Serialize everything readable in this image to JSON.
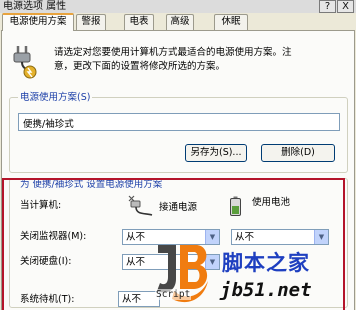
{
  "window": {
    "title": "电源选项 属性",
    "help_label": "?",
    "close_label": "X"
  },
  "tabs": [
    {
      "label": "电源使用方案"
    },
    {
      "label": "警报"
    },
    {
      "label": "电表"
    },
    {
      "label": "高级"
    },
    {
      "label": "休眠"
    }
  ],
  "intro": {
    "line1": "请选定对您要使用计算机方式最适合的电源使用方案。注",
    "line2": "意，更改下面的设置将修改所选的方案。"
  },
  "scheme": {
    "legend": "电源使用方案(S)",
    "selected": "便携/袖珍式",
    "save_as_label": "另存为(S)...",
    "delete_label": "删除(D)"
  },
  "settings": {
    "legend": "为 便携/袖珍式 设置电源使用方案",
    "when_label": "当计算机:",
    "plugged_label": "接通电源",
    "battery_label": "使用电池",
    "monitor_label": "关闭监视器(M):",
    "disk_label": "关闭硬盘(I):",
    "standby_label": "系统待机(T):",
    "monitor_ac": "从不",
    "monitor_dc": "从不",
    "disk_ac": "从不",
    "standby_ac": "从不"
  },
  "watermark": {
    "logo_text": "Script",
    "brand": "脚本之家",
    "url": "jb51.net"
  },
  "colors": {
    "highlight": "#b4142a",
    "tab_accent": "#e8a33d",
    "group_title": "#1c3fa8"
  }
}
